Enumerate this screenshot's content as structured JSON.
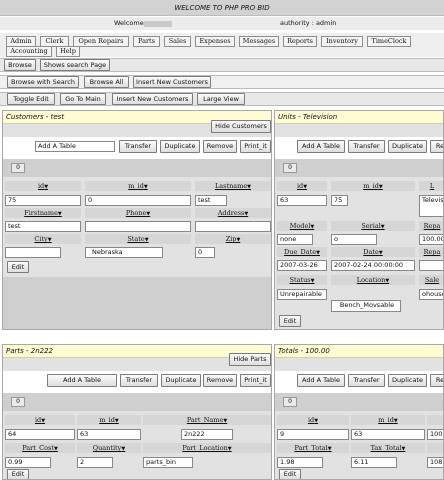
{
  "header": {
    "title": "WELCOME TO PHP PRO BID"
  },
  "info": {
    "welcome": "Welcome",
    "authority": "authority : admin"
  },
  "tabs_row1": [
    "Admin",
    "Clerk",
    "Open Repairs",
    "Parts",
    "Sales",
    "Expenses",
    "Messages",
    "Reports",
    "Inventory",
    "TimeClock"
  ],
  "tabs_row2": [
    "Accounting",
    "Help"
  ],
  "bar1": {
    "browse": "Browse",
    "shows": "Shows search Page"
  },
  "bar2": {
    "search": "Browse with Search",
    "all": "Browse All",
    "insert": "Insert New Customers"
  },
  "bar3": {
    "toggle": "Toggle Edit",
    "main": "Go To Main",
    "insert": "Insert New Customers",
    "large": "Large View"
  },
  "common": {
    "add_table": "Add A Table",
    "transfer": "Transfer",
    "duplicate": "Duplicate",
    "remove": "Remove",
    "print": "Print_it",
    "zero": "0",
    "edit": "Edit",
    "print_short": "Re"
  },
  "customers": {
    "title": "Customers - test",
    "hide": "Hide Customers",
    "labels": [
      "id",
      "m_id",
      "Lastname",
      "Firstname",
      "Phone",
      "Address",
      "City",
      "State",
      "Zip"
    ],
    "values": {
      "id": "75",
      "m_id": "0",
      "Lastname": "test",
      "Firstname": "test",
      "Phone": "",
      "Address": "",
      "City": "",
      "State": "Nebraska",
      "Zip": "0"
    }
  },
  "units": {
    "title": "Units - Television",
    "labels": [
      "id",
      "m_id",
      "L",
      "Model",
      "Serial",
      "Repa",
      "Due_Date",
      "Date",
      "Repa",
      "Status",
      "Location",
      "Sale"
    ],
    "values": {
      "id": "63",
      "m_id": "75",
      "type": "Televis",
      "Model": "none",
      "Serial": "o",
      "price": "100.00",
      "Due_Date": "2007-03-26",
      "Date": "2007-02-24 00:00:00",
      "Status": "Unrepairable",
      "Location": "Bench_Movsable",
      "sold": "ohouse"
    }
  },
  "parts": {
    "title": "Parts - 2n222",
    "hide": "Hide Parts",
    "labels": [
      "id",
      "m_id",
      "Part_Name",
      "Part_Cost",
      "Quantity",
      "Part_Location"
    ],
    "values": {
      "id": "64",
      "m_id": "63",
      "Part_Name": "2n222",
      "Part_Cost": "0.99",
      "Quantity": "2",
      "Part_Location": "parts_bin"
    }
  },
  "totals": {
    "title": "Totals - 100.00",
    "labels": [
      "id",
      "m_id",
      "",
      "Part_Total",
      "Tax_Total",
      ""
    ],
    "values": {
      "id": "9",
      "m_id": "63",
      "c3": "100.",
      "Part_Total": "1.98",
      "Tax_Total": "6.11",
      "c6": "108."
    }
  }
}
